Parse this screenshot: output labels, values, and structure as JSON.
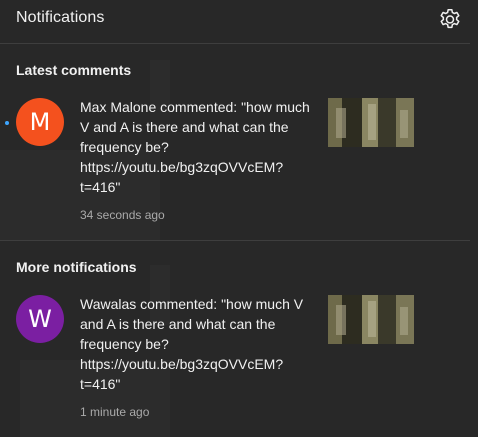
{
  "header": {
    "title": "Notifications",
    "settings_icon": "gear-icon"
  },
  "sections": [
    {
      "title": "Latest comments",
      "items": [
        {
          "unread": true,
          "avatar_letter": "M",
          "avatar_color": "#f4511e",
          "message": "Max Malone commented: \"how much V and A is there and what can the frequency be? https://youtu.be/bg3zqOVVcEM?t=416\"",
          "time": "34 seconds ago"
        }
      ]
    },
    {
      "title": "More notifications",
      "items": [
        {
          "unread": false,
          "avatar_letter": "W",
          "avatar_color": "#7b1fa2",
          "message": "Wawalas commented: \"how much V and A is there and what can the frequency be? https://youtu.be/bg3zqOVVcEM?t=416\"",
          "time": "1 minute ago"
        }
      ]
    }
  ],
  "colors": {
    "background": "#282828",
    "text": "#f1f1f1",
    "secondary_text": "#aaaaaa",
    "unread_dot": "#3ea6ff",
    "divider": "#3e3e3e"
  }
}
